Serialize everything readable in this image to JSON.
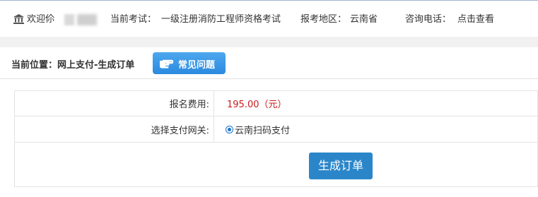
{
  "header": {
    "welcome_label": "欢迎伱",
    "exam_label": "当前考试：",
    "exam_value": "一级注册消防工程师资格考试",
    "region_label": "报考地区：",
    "region_value": "云南省",
    "phone_label": "咨询电话：",
    "phone_link": "点击查看"
  },
  "location": {
    "label": "当前位置：",
    "path": "网上支付-生成订单"
  },
  "faq_button": "常见问题",
  "form": {
    "fee_label": "报名费用:",
    "fee_value": "195.00（元）",
    "gateway_label": "选择支付网关:",
    "gateway_option": "云南扫码支付",
    "submit_label": "生成订单"
  },
  "colors": {
    "accent_blue": "#1a73c9",
    "button_blue": "#2b86c9",
    "fee_red": "#c81c1c"
  },
  "icons": {
    "welcome": "bank-icon",
    "faq": "pointing-hand-icon",
    "radio": "radio-selected-icon"
  }
}
